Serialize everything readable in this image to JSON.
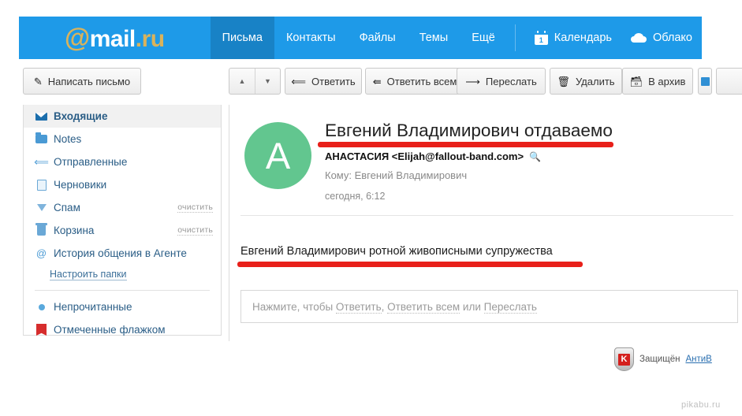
{
  "header": {
    "logo": {
      "at": "@",
      "mail": "mail",
      "dot": ".",
      "ru": "ru"
    },
    "nav": [
      {
        "label": "Письма",
        "active": true
      },
      {
        "label": "Контакты",
        "active": false
      },
      {
        "label": "Файлы",
        "active": false
      },
      {
        "label": "Темы",
        "active": false
      },
      {
        "label": "Ещё",
        "active": false
      }
    ],
    "right": [
      {
        "label": "Календарь",
        "icon": "calendar-icon",
        "badge": "1"
      },
      {
        "label": "Облако",
        "icon": "cloud-icon"
      }
    ],
    "accent_color": "#1e9ae8",
    "active_tab_color": "#1882c6"
  },
  "toolbar": {
    "compose": "Написать письмо",
    "sort_up": "▲",
    "sort_down": "▼",
    "reply": "Ответить",
    "reply_all": "Ответить всем",
    "forward": "Переслать",
    "delete": "Удалить",
    "archive": "В архив"
  },
  "sidebar": {
    "folders": [
      {
        "label": "Входящие",
        "icon": "envelope-icon",
        "active": true,
        "clear": ""
      },
      {
        "label": "Notes",
        "icon": "folder-icon",
        "active": false,
        "clear": ""
      },
      {
        "label": "Отправленные",
        "icon": "sent-arrow-icon",
        "active": false,
        "clear": ""
      },
      {
        "label": "Черновики",
        "icon": "document-icon",
        "active": false,
        "clear": ""
      },
      {
        "label": "Спам",
        "icon": "spam-pin-icon",
        "active": false,
        "clear": "очистить"
      },
      {
        "label": "Корзина",
        "icon": "trash-icon",
        "active": false,
        "clear": "очистить"
      },
      {
        "label": "История общения в Агенте",
        "icon": "at-icon",
        "active": false,
        "clear": ""
      }
    ],
    "settings_link": "Настроить папки",
    "filters": [
      {
        "label": "Непрочитанные",
        "icon": "blue-dot-icon"
      },
      {
        "label": "Отмеченные флажком",
        "icon": "red-flag-icon"
      }
    ]
  },
  "message": {
    "avatar_letter": "A",
    "avatar_color": "#62c68f",
    "subject": "Евгений Владимирович отдаваемо",
    "sender": "АНАСТАСИЯ <Elijah@fallout-band.com>",
    "recipient": "Кому: Евгений Владимирович",
    "timestamp": "сегодня, 6:12",
    "body": "Евгений Владимирович ротной живописными супружества",
    "highlight_color": "#e8201a"
  },
  "reply": {
    "placeholder_prefix": "Нажмите, чтобы ",
    "reply_word": "Ответить",
    "comma": ", ",
    "reply_all_word": "Ответить всем",
    "or_word": " или ",
    "forward_word": "Переслать"
  },
  "antivirus": {
    "logo_letter": "K",
    "text": "Защищён",
    "link": "АнтиВ"
  },
  "watermark": "pikabu.ru"
}
